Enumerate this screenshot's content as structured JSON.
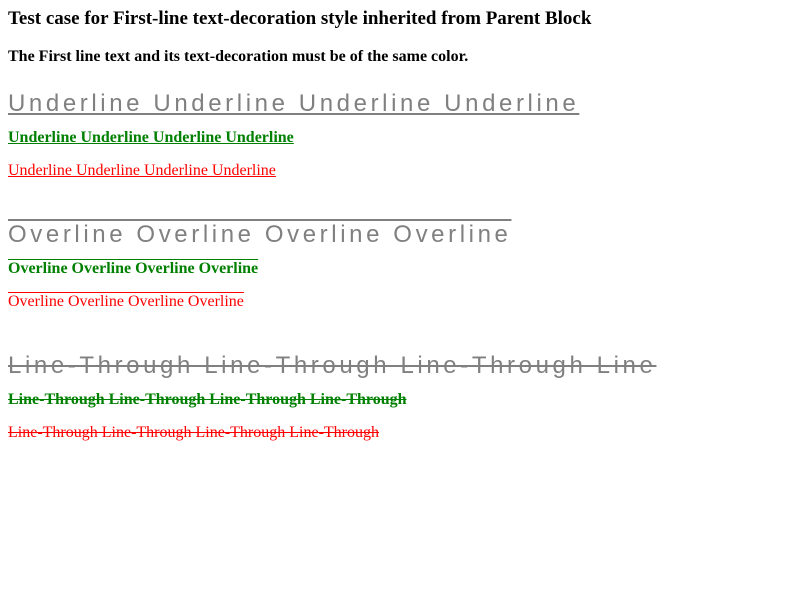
{
  "colors": {
    "first_line": "#808080",
    "green": "#008000",
    "red": "#ff0000"
  },
  "header": {
    "title": "Test case for First-line text-decoration style inherited from Parent Block",
    "instruction": "The First line text and its text-decoration must be of the same color."
  },
  "underline": {
    "first_line": "Underline Underline Underline Underline",
    "green_line": "Underline Underline Underline Underline",
    "red_line": "Underline Underline Underline Underline"
  },
  "overline": {
    "first_line": "Overline Overline Overline Overline",
    "green_line": "Overline Overline Overline Overline",
    "red_line": "Overline Overline Overline Overline"
  },
  "line_through": {
    "first_line": "Line-Through Line-Through Line-Through Line",
    "green_line": "Line-Through Line-Through Line-Through Line-Through",
    "red_line": "Line-Through Line-Through Line-Through Line-Through"
  }
}
